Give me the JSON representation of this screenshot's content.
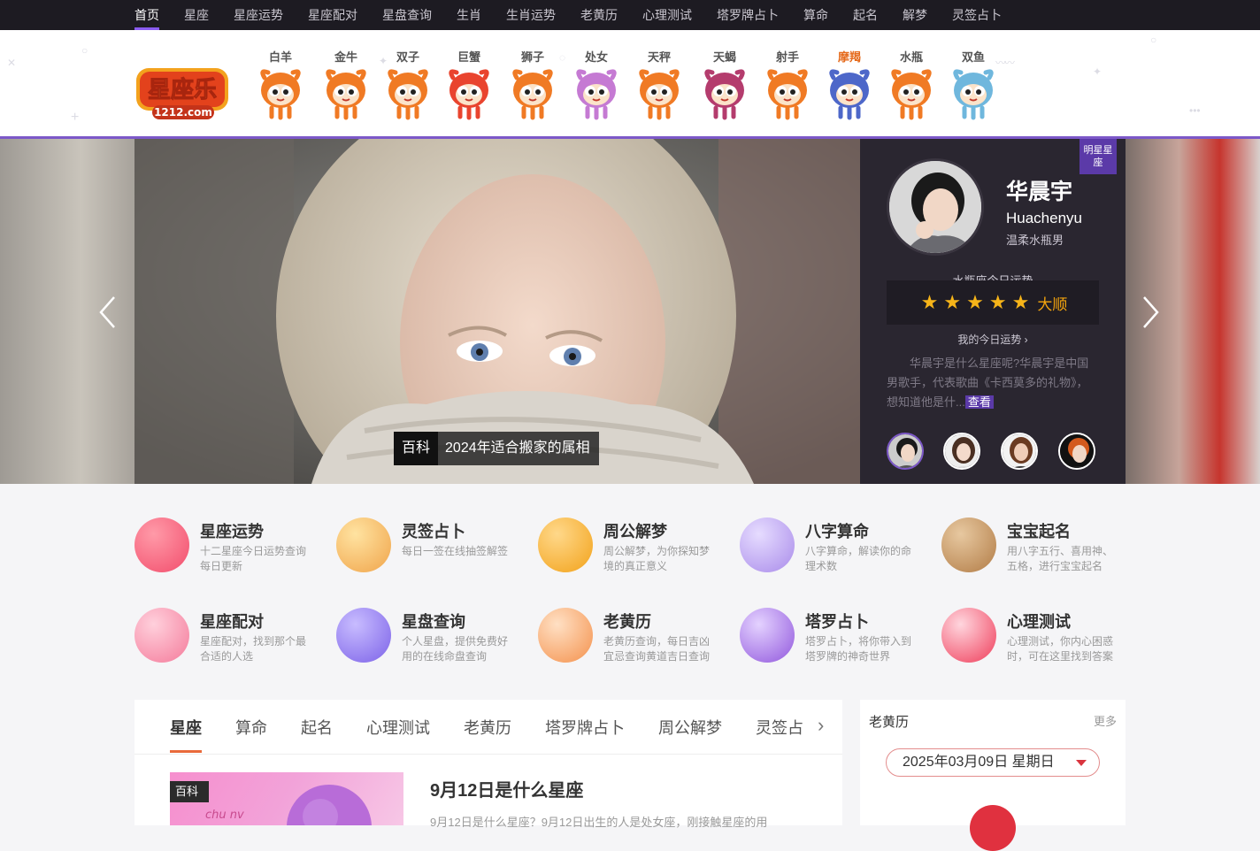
{
  "topnav": {
    "items": [
      {
        "label": "首页",
        "active": true
      },
      {
        "label": "星座"
      },
      {
        "label": "星座运势"
      },
      {
        "label": "星座配对"
      },
      {
        "label": "星盘查询"
      },
      {
        "label": "生肖"
      },
      {
        "label": "生肖运势"
      },
      {
        "label": "老黄历"
      },
      {
        "label": "心理测试"
      },
      {
        "label": "塔罗牌占卜"
      },
      {
        "label": "算命"
      },
      {
        "label": "起名"
      },
      {
        "label": "解梦"
      },
      {
        "label": "灵签占卜"
      }
    ]
  },
  "header": {
    "logo_text": "星座乐",
    "logo_sub": "1212.com",
    "zodiacs": [
      {
        "label": "白羊",
        "color": "#f07a24"
      },
      {
        "label": "金牛",
        "color": "#f07a24"
      },
      {
        "label": "双子",
        "color": "#f07a24"
      },
      {
        "label": "巨蟹",
        "color": "#e9442e"
      },
      {
        "label": "狮子",
        "color": "#f07a24"
      },
      {
        "label": "处女",
        "color": "#c57ad3"
      },
      {
        "label": "天秤",
        "color": "#f07a24"
      },
      {
        "label": "天蝎",
        "color": "#b43c6d"
      },
      {
        "label": "射手",
        "color": "#f07a24"
      },
      {
        "label": "摩羯",
        "color": "#4d67c9",
        "active": true
      },
      {
        "label": "水瓶",
        "color": "#f07a24"
      },
      {
        "label": "双鱼",
        "color": "#6fb7dd"
      }
    ]
  },
  "banner": {
    "prev_icon": "chevron-left-icon",
    "next_icon": "chevron-right-icon",
    "caption_tag": "百科",
    "caption_text": "2024年适合搬家的属相"
  },
  "star_panel": {
    "badge": "明星星座",
    "name": "华晨宇",
    "pinyin": "Huachenyu",
    "desc": "温柔水瓶男",
    "fortune_title": "水瓶座今日运势",
    "stars": 5,
    "fortune_level": "大顺",
    "my_today": "我的今日运势 ›",
    "intro": "华晨宇是什么星座呢?华晨宇是中国男歌手，代表歌曲《卡西莫多的礼物》，想知道他是什...",
    "intro_more": "查看"
  },
  "services": [
    {
      "title": "星座运势",
      "desc": "十二星座今日运势查询每日更新",
      "color1": "#ff9aa8",
      "color2": "#f24d6c"
    },
    {
      "title": "灵签占卜",
      "desc": "每日一签在线抽签解签",
      "color1": "#ffe3a1",
      "color2": "#f0a44a"
    },
    {
      "title": "周公解梦",
      "desc": "周公解梦，为你探知梦境的真正意义",
      "color1": "#ffd88a",
      "color2": "#f2a21a"
    },
    {
      "title": "八字算命",
      "desc": "八字算命，解读你的命理术数",
      "color1": "#e6dcff",
      "color2": "#a98bea"
    },
    {
      "title": "宝宝起名",
      "desc": "用八字五行、喜用神、五格，进行宝宝起名",
      "color1": "#e7c8a0",
      "color2": "#b27c46"
    },
    {
      "title": "星座配对",
      "desc": "星座配对，找到那个最合适的人选",
      "color1": "#ffd0dc",
      "color2": "#f47a9a"
    },
    {
      "title": "星盘查询",
      "desc": "个人星盘，提供免费好用的在线命盘查询",
      "color1": "#c8bcff",
      "color2": "#7c62e8"
    },
    {
      "title": "老黄历",
      "desc": "老黄历查询，每日吉凶宜忌查询黄道吉日查询",
      "color1": "#ffe0c4",
      "color2": "#f4914c"
    },
    {
      "title": "塔罗占卜",
      "desc": "塔罗占卜，将你带入到塔罗牌的神奇世界",
      "color1": "#e4d2ff",
      "color2": "#9157dd"
    },
    {
      "title": "心理测试",
      "desc": "心理测试，你内心困惑时，可在这里找到答案",
      "color1": "#ffd6de",
      "color2": "#ef3d5a"
    }
  ],
  "content_tabs": {
    "tabs": [
      {
        "label": "星座",
        "active": true
      },
      {
        "label": "算命"
      },
      {
        "label": "起名"
      },
      {
        "label": "心理测试"
      },
      {
        "label": "老黄历"
      },
      {
        "label": "塔罗牌占卜"
      },
      {
        "label": "周公解梦"
      },
      {
        "label": "灵签占"
      }
    ],
    "next_icon": "chevron-right-icon",
    "article": {
      "tag": "百科",
      "title": "9月12日是什么星座",
      "summary": "9月12日是什么星座？9月12日出生的人是处女座，刚接触星座的用"
    }
  },
  "calendar": {
    "title": "老黄历",
    "more": "更多",
    "date": "2025年03月09日 星期日"
  }
}
